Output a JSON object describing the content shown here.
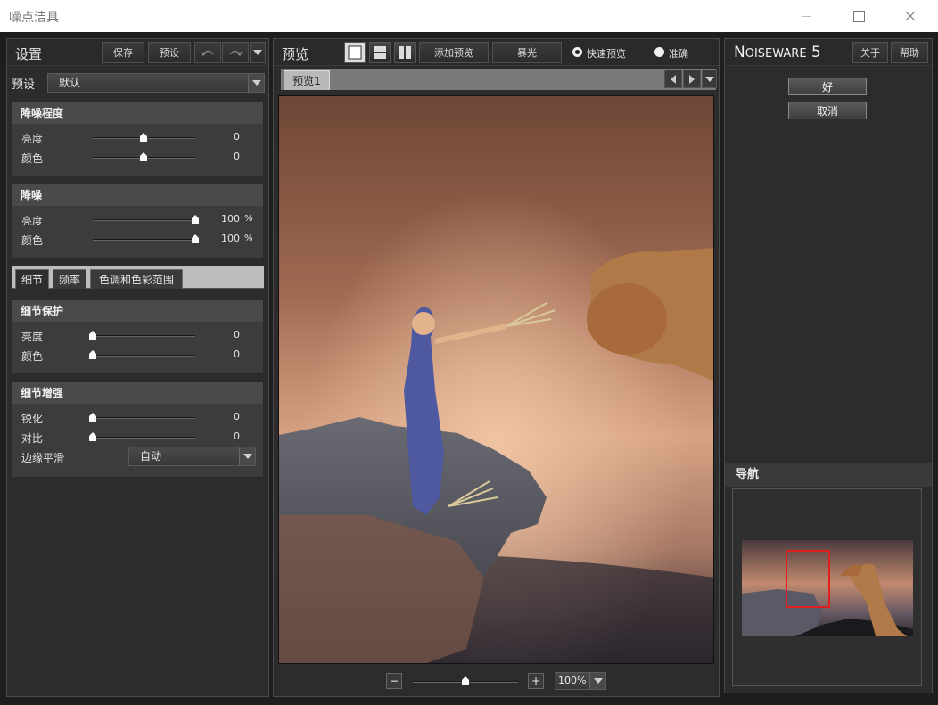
{
  "window": {
    "title": "噪点洁具"
  },
  "settings": {
    "title": "设置",
    "save": "保存",
    "preset": "预设",
    "preset_label": "预设",
    "preset_value": "默认"
  },
  "noise_level": {
    "title": "降噪程度",
    "rows": [
      {
        "label": "亮度",
        "value": "0",
        "level": 0.5
      },
      {
        "label": "颜色",
        "value": "0",
        "level": 0.5
      }
    ]
  },
  "noise_reduction": {
    "title": "降噪",
    "rows": [
      {
        "label": "亮度",
        "value": "100",
        "unit": "%",
        "level": 1.0
      },
      {
        "label": "颜色",
        "value": "100",
        "unit": "%",
        "level": 1.0
      }
    ]
  },
  "tabs": [
    "细节",
    "频率",
    "色调和色彩范围"
  ],
  "detail_protection": {
    "title": "细节保护",
    "rows": [
      {
        "label": "亮度",
        "value": "0",
        "level": 0.0
      },
      {
        "label": "颜色",
        "value": "0",
        "level": 0.0
      }
    ]
  },
  "detail_enhance": {
    "title": "细节增强",
    "rows": [
      {
        "label": "锐化",
        "value": "0",
        "level": 0.0
      },
      {
        "label": "对比",
        "value": "0",
        "level": 0.0
      }
    ],
    "edge_label": "边缘平滑",
    "edge_value": "自动"
  },
  "preview": {
    "title": "预览",
    "add_preview": "添加预览",
    "exposure": "暴光",
    "fast_preview": "快速预览",
    "accurate": "准确",
    "tab": "预览1",
    "zoom": "100%",
    "zoom_level": 0.5
  },
  "brand": {
    "logo_a": "N",
    "logo_b": "OISE",
    "logo_c": "WARE",
    "logo_ver": "5",
    "about": "关于",
    "help": "帮助",
    "ok": "好",
    "cancel": "取消",
    "navigation": "导航"
  },
  "colors": {
    "accent_red": "#e02020",
    "panel_bg": "#2c2c2c"
  }
}
